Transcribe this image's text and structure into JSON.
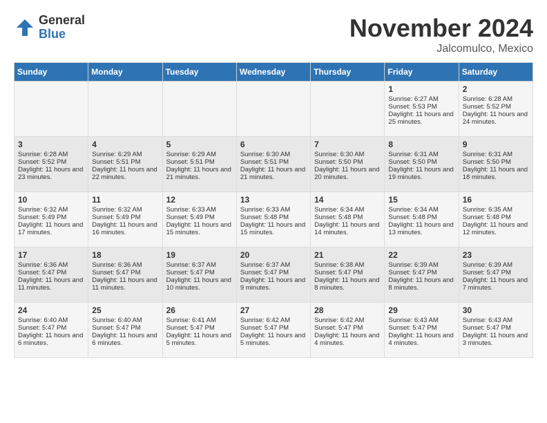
{
  "logo": {
    "general": "General",
    "blue": "Blue"
  },
  "title": {
    "month": "November 2024",
    "location": "Jalcomulco, Mexico"
  },
  "days_of_week": [
    "Sunday",
    "Monday",
    "Tuesday",
    "Wednesday",
    "Thursday",
    "Friday",
    "Saturday"
  ],
  "weeks": [
    [
      {
        "day": "",
        "sunrise": "",
        "sunset": "",
        "daylight": ""
      },
      {
        "day": "",
        "sunrise": "",
        "sunset": "",
        "daylight": ""
      },
      {
        "day": "",
        "sunrise": "",
        "sunset": "",
        "daylight": ""
      },
      {
        "day": "",
        "sunrise": "",
        "sunset": "",
        "daylight": ""
      },
      {
        "day": "",
        "sunrise": "",
        "sunset": "",
        "daylight": ""
      },
      {
        "day": "1",
        "sunrise": "Sunrise: 6:27 AM",
        "sunset": "Sunset: 5:53 PM",
        "daylight": "Daylight: 11 hours and 25 minutes."
      },
      {
        "day": "2",
        "sunrise": "Sunrise: 6:28 AM",
        "sunset": "Sunset: 5:52 PM",
        "daylight": "Daylight: 11 hours and 24 minutes."
      }
    ],
    [
      {
        "day": "3",
        "sunrise": "Sunrise: 6:28 AM",
        "sunset": "Sunset: 5:52 PM",
        "daylight": "Daylight: 11 hours and 23 minutes."
      },
      {
        "day": "4",
        "sunrise": "Sunrise: 6:29 AM",
        "sunset": "Sunset: 5:51 PM",
        "daylight": "Daylight: 11 hours and 22 minutes."
      },
      {
        "day": "5",
        "sunrise": "Sunrise: 6:29 AM",
        "sunset": "Sunset: 5:51 PM",
        "daylight": "Daylight: 11 hours and 21 minutes."
      },
      {
        "day": "6",
        "sunrise": "Sunrise: 6:30 AM",
        "sunset": "Sunset: 5:51 PM",
        "daylight": "Daylight: 11 hours and 21 minutes."
      },
      {
        "day": "7",
        "sunrise": "Sunrise: 6:30 AM",
        "sunset": "Sunset: 5:50 PM",
        "daylight": "Daylight: 11 hours and 20 minutes."
      },
      {
        "day": "8",
        "sunrise": "Sunrise: 6:31 AM",
        "sunset": "Sunset: 5:50 PM",
        "daylight": "Daylight: 11 hours and 19 minutes."
      },
      {
        "day": "9",
        "sunrise": "Sunrise: 6:31 AM",
        "sunset": "Sunset: 5:50 PM",
        "daylight": "Daylight: 11 hours and 18 minutes."
      }
    ],
    [
      {
        "day": "10",
        "sunrise": "Sunrise: 6:32 AM",
        "sunset": "Sunset: 5:49 PM",
        "daylight": "Daylight: 11 hours and 17 minutes."
      },
      {
        "day": "11",
        "sunrise": "Sunrise: 6:32 AM",
        "sunset": "Sunset: 5:49 PM",
        "daylight": "Daylight: 11 hours and 16 minutes."
      },
      {
        "day": "12",
        "sunrise": "Sunrise: 6:33 AM",
        "sunset": "Sunset: 5:49 PM",
        "daylight": "Daylight: 11 hours and 15 minutes."
      },
      {
        "day": "13",
        "sunrise": "Sunrise: 6:33 AM",
        "sunset": "Sunset: 5:48 PM",
        "daylight": "Daylight: 11 hours and 15 minutes."
      },
      {
        "day": "14",
        "sunrise": "Sunrise: 6:34 AM",
        "sunset": "Sunset: 5:48 PM",
        "daylight": "Daylight: 11 hours and 14 minutes."
      },
      {
        "day": "15",
        "sunrise": "Sunrise: 6:34 AM",
        "sunset": "Sunset: 5:48 PM",
        "daylight": "Daylight: 11 hours and 13 minutes."
      },
      {
        "day": "16",
        "sunrise": "Sunrise: 6:35 AM",
        "sunset": "Sunset: 5:48 PM",
        "daylight": "Daylight: 11 hours and 12 minutes."
      }
    ],
    [
      {
        "day": "17",
        "sunrise": "Sunrise: 6:36 AM",
        "sunset": "Sunset: 5:47 PM",
        "daylight": "Daylight: 11 hours and 11 minutes."
      },
      {
        "day": "18",
        "sunrise": "Sunrise: 6:36 AM",
        "sunset": "Sunset: 5:47 PM",
        "daylight": "Daylight: 11 hours and 11 minutes."
      },
      {
        "day": "19",
        "sunrise": "Sunrise: 6:37 AM",
        "sunset": "Sunset: 5:47 PM",
        "daylight": "Daylight: 11 hours and 10 minutes."
      },
      {
        "day": "20",
        "sunrise": "Sunrise: 6:37 AM",
        "sunset": "Sunset: 5:47 PM",
        "daylight": "Daylight: 11 hours and 9 minutes."
      },
      {
        "day": "21",
        "sunrise": "Sunrise: 6:38 AM",
        "sunset": "Sunset: 5:47 PM",
        "daylight": "Daylight: 11 hours and 8 minutes."
      },
      {
        "day": "22",
        "sunrise": "Sunrise: 6:39 AM",
        "sunset": "Sunset: 5:47 PM",
        "daylight": "Daylight: 11 hours and 8 minutes."
      },
      {
        "day": "23",
        "sunrise": "Sunrise: 6:39 AM",
        "sunset": "Sunset: 5:47 PM",
        "daylight": "Daylight: 11 hours and 7 minutes."
      }
    ],
    [
      {
        "day": "24",
        "sunrise": "Sunrise: 6:40 AM",
        "sunset": "Sunset: 5:47 PM",
        "daylight": "Daylight: 11 hours and 6 minutes."
      },
      {
        "day": "25",
        "sunrise": "Sunrise: 6:40 AM",
        "sunset": "Sunset: 5:47 PM",
        "daylight": "Daylight: 11 hours and 6 minutes."
      },
      {
        "day": "26",
        "sunrise": "Sunrise: 6:41 AM",
        "sunset": "Sunset: 5:47 PM",
        "daylight": "Daylight: 11 hours and 5 minutes."
      },
      {
        "day": "27",
        "sunrise": "Sunrise: 6:42 AM",
        "sunset": "Sunset: 5:47 PM",
        "daylight": "Daylight: 11 hours and 5 minutes."
      },
      {
        "day": "28",
        "sunrise": "Sunrise: 6:42 AM",
        "sunset": "Sunset: 5:47 PM",
        "daylight": "Daylight: 11 hours and 4 minutes."
      },
      {
        "day": "29",
        "sunrise": "Sunrise: 6:43 AM",
        "sunset": "Sunset: 5:47 PM",
        "daylight": "Daylight: 11 hours and 4 minutes."
      },
      {
        "day": "30",
        "sunrise": "Sunrise: 6:43 AM",
        "sunset": "Sunset: 5:47 PM",
        "daylight": "Daylight: 11 hours and 3 minutes."
      }
    ]
  ]
}
